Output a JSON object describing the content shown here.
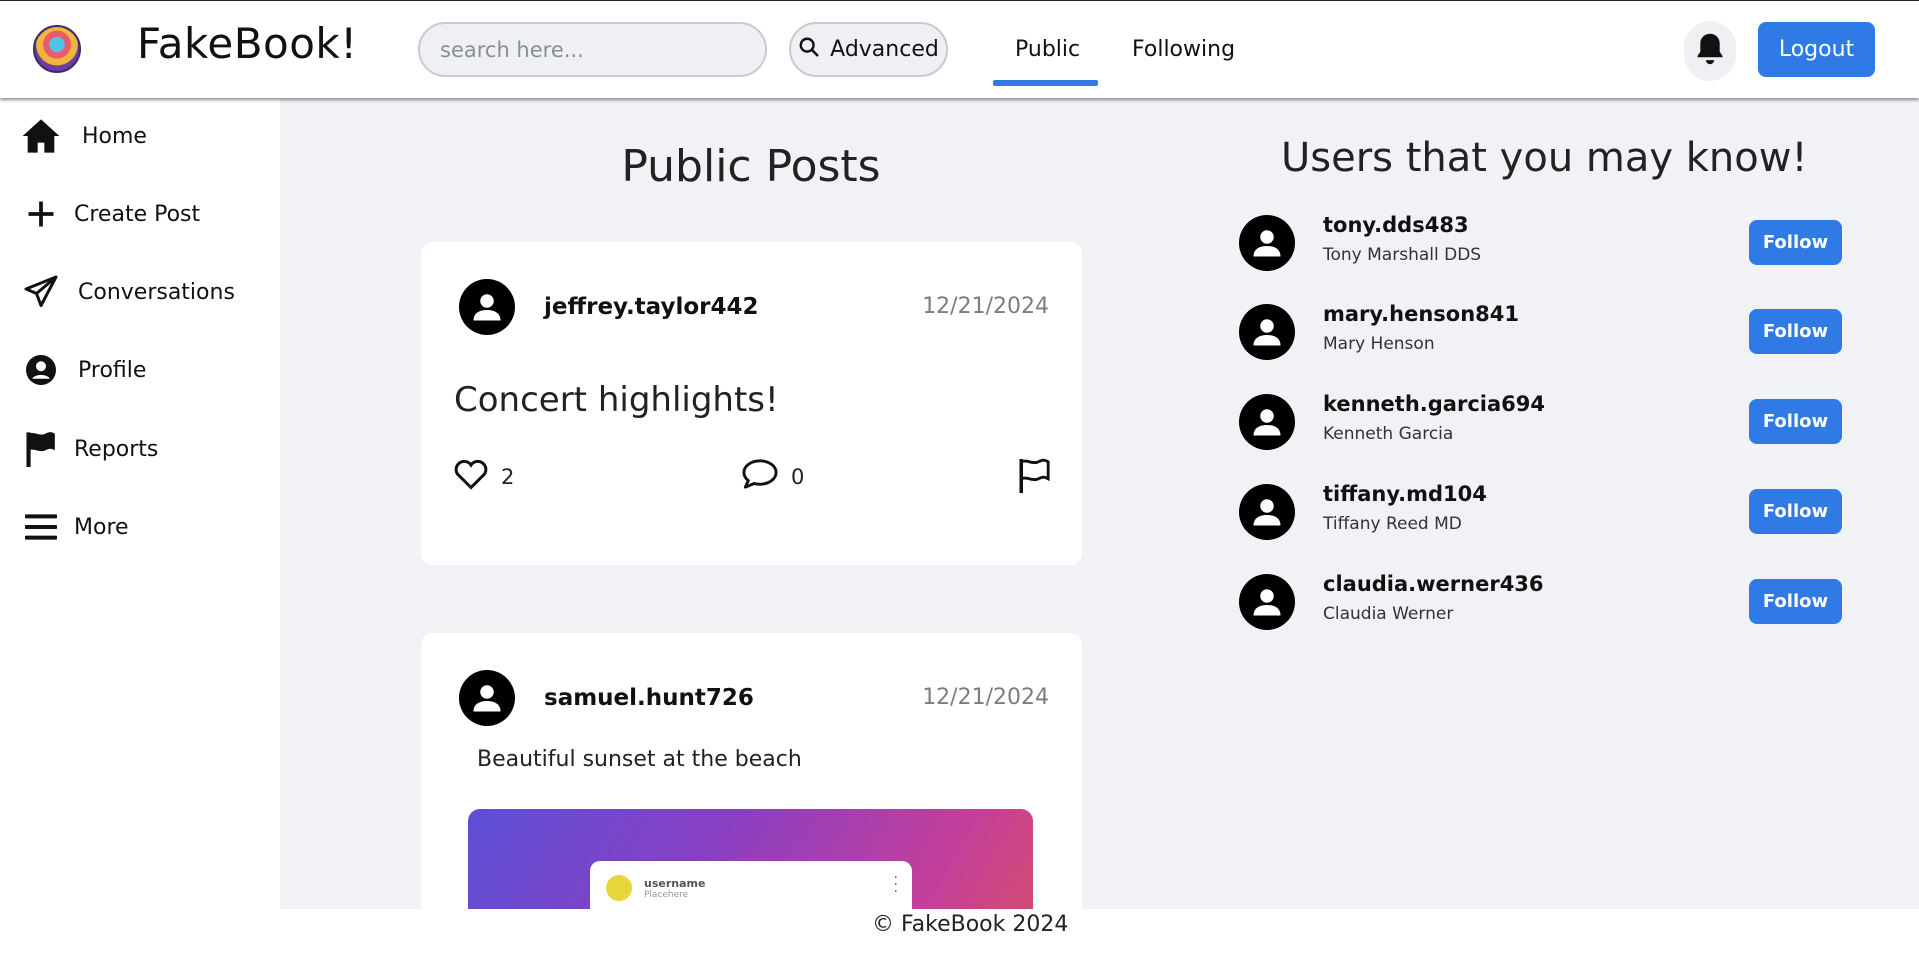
{
  "header": {
    "brand": "FakeBook!",
    "search_placeholder": "search here...",
    "advanced_label": "Advanced",
    "tabs": [
      {
        "label": "Public",
        "active": true
      },
      {
        "label": "Following",
        "active": false
      }
    ],
    "logout_label": "Logout",
    "accent_color": "#2f7ae5"
  },
  "sidebar": {
    "items": [
      {
        "label": "Home",
        "icon": "home-icon"
      },
      {
        "label": "Create Post",
        "icon": "plus-icon"
      },
      {
        "label": "Conversations",
        "icon": "paper-plane-icon"
      },
      {
        "label": "Profile",
        "icon": "user-circle-icon"
      },
      {
        "label": "Reports",
        "icon": "flag-icon"
      },
      {
        "label": "More",
        "icon": "menu-icon"
      }
    ]
  },
  "feed": {
    "title": "Public Posts",
    "posts": [
      {
        "username": "jeffrey.taylor442",
        "date": "12/21/2024",
        "text": "Concert highlights!",
        "likes": "2",
        "comments": "0"
      },
      {
        "username": "samuel.hunt726",
        "date": "12/21/2024",
        "text": "Beautiful sunset at the beach",
        "image": {
          "card_user": "username",
          "card_sub": "Placehere"
        }
      }
    ]
  },
  "suggestions": {
    "title": "Users that you may know!",
    "follow_label": "Follow",
    "users": [
      {
        "username": "tony.dds483",
        "name": "Tony Marshall DDS"
      },
      {
        "username": "mary.henson841",
        "name": "Mary Henson"
      },
      {
        "username": "kenneth.garcia694",
        "name": "Kenneth Garcia"
      },
      {
        "username": "tiffany.md104",
        "name": "Tiffany Reed MD"
      },
      {
        "username": "claudia.werner436",
        "name": "Claudia Werner"
      }
    ]
  },
  "footer": {
    "text": "© FakeBook 2024"
  }
}
